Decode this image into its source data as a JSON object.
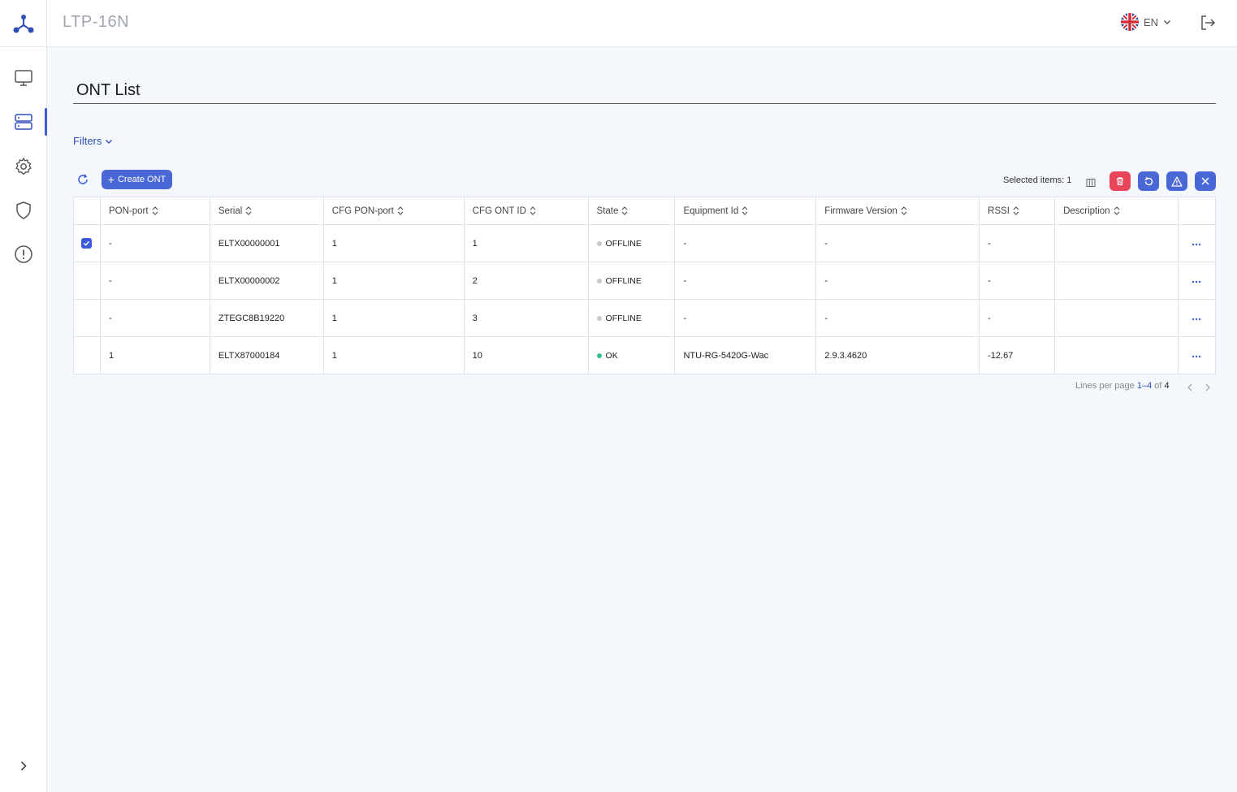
{
  "header": {
    "app_title": "LTP-16N",
    "language": "EN"
  },
  "page": {
    "title": "ONT List",
    "filters_label": "Filters"
  },
  "toolbar": {
    "create_label": "Create ONT",
    "selected_label": "Selected items: 1"
  },
  "table": {
    "columns": [
      "PON-port",
      "Serial",
      "CFG PON-port",
      "CFG ONT ID",
      "State",
      "Equipment Id",
      "Firmware Version",
      "RSSI",
      "Description"
    ],
    "rows": [
      {
        "checked": true,
        "pon_port": "-",
        "serial": "ELTX00000001",
        "cfg_pon_port": "1",
        "cfg_ont_id": "1",
        "state": "OFFLINE",
        "equipment_id": "-",
        "firmware": "-",
        "rssi": "-",
        "description": ""
      },
      {
        "checked": false,
        "pon_port": "-",
        "serial": "ELTX00000002",
        "cfg_pon_port": "1",
        "cfg_ont_id": "2",
        "state": "OFFLINE",
        "equipment_id": "-",
        "firmware": "-",
        "rssi": "-",
        "description": ""
      },
      {
        "checked": false,
        "pon_port": "-",
        "serial": "ZTEGC8B19220",
        "cfg_pon_port": "1",
        "cfg_ont_id": "3",
        "state": "OFFLINE",
        "equipment_id": "-",
        "firmware": "-",
        "rssi": "-",
        "description": ""
      },
      {
        "checked": false,
        "pon_port": "1",
        "serial": "ELTX87000184",
        "cfg_pon_port": "1",
        "cfg_ont_id": "10",
        "state": "OK",
        "equipment_id": "NTU-RG-5420G-Wac",
        "firmware": "2.9.3.4620",
        "rssi": "-12.67",
        "description": ""
      }
    ]
  },
  "pagination": {
    "lines_label": "Lines per page",
    "range": "1–4",
    "of": "of",
    "total": "4"
  },
  "colors": {
    "accent": "#4a67d6",
    "danger": "#e8455a",
    "offline": "#c8c8c8",
    "ok": "#2fbf8a"
  }
}
